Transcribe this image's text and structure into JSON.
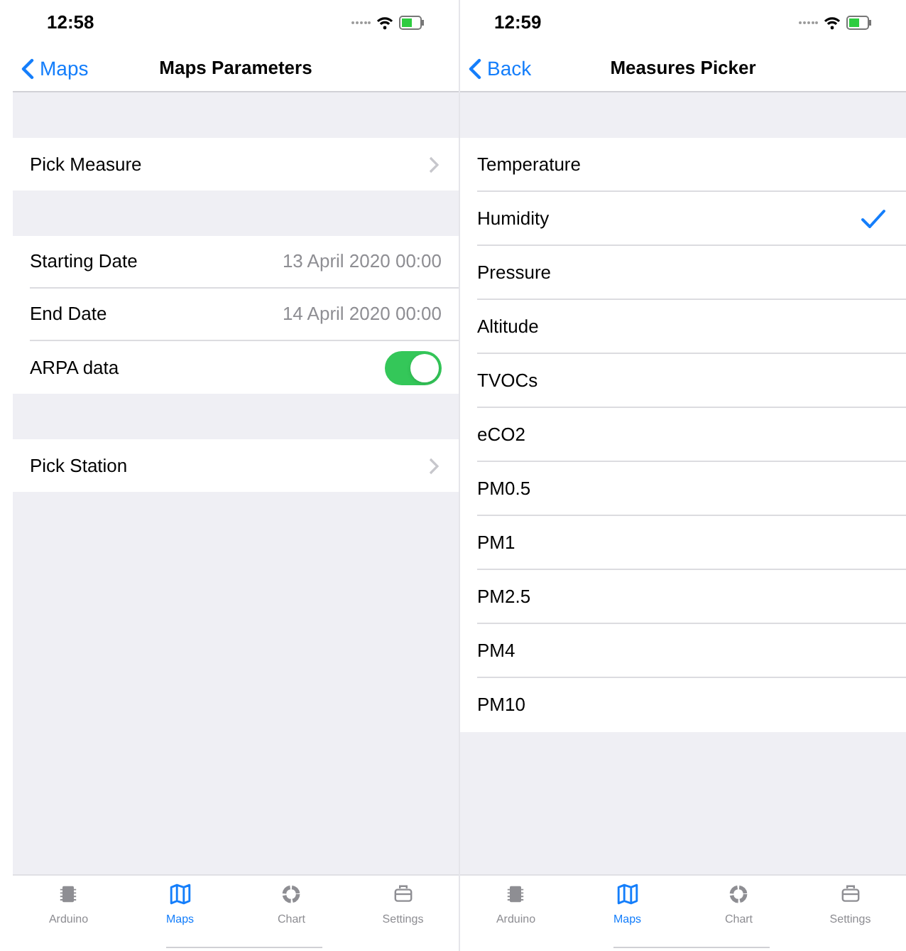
{
  "screens": [
    {
      "status_bar": {
        "time": "12:58"
      },
      "nav": {
        "back": "Maps",
        "title": "Maps Parameters"
      },
      "groups": [
        {
          "rows": [
            {
              "kind": "disclosure",
              "label": "Pick Measure"
            }
          ]
        },
        {
          "rows": [
            {
              "kind": "value",
              "label": "Starting Date",
              "value": "13 April 2020 00:00"
            },
            {
              "kind": "value",
              "label": "End Date",
              "value": "14 April 2020 00:00"
            },
            {
              "kind": "toggle",
              "label": "ARPA data",
              "on": true
            }
          ]
        },
        {
          "rows": [
            {
              "kind": "disclosure",
              "label": "Pick Station"
            }
          ]
        }
      ],
      "tabs": [
        {
          "kind": "chip",
          "label": "Arduino",
          "selected": false
        },
        {
          "kind": "map",
          "label": "Maps",
          "selected": true
        },
        {
          "kind": "ring",
          "label": "Chart",
          "selected": false
        },
        {
          "kind": "case",
          "label": "Settings",
          "selected": false
        }
      ]
    },
    {
      "status_bar": {
        "time": "12:59"
      },
      "nav": {
        "back": "Back",
        "title": "Measures Picker"
      },
      "groups": [
        {
          "rows": [
            {
              "kind": "choice",
              "label": "Temperature",
              "selected": false
            },
            {
              "kind": "choice",
              "label": "Humidity",
              "selected": true
            },
            {
              "kind": "choice",
              "label": "Pressure",
              "selected": false
            },
            {
              "kind": "choice",
              "label": "Altitude",
              "selected": false
            },
            {
              "kind": "choice",
              "label": "TVOCs",
              "selected": false
            },
            {
              "kind": "choice",
              "label": "eCO2",
              "selected": false
            },
            {
              "kind": "choice",
              "label": "PM0.5",
              "selected": false
            },
            {
              "kind": "choice",
              "label": "PM1",
              "selected": false
            },
            {
              "kind": "choice",
              "label": "PM2.5",
              "selected": false
            },
            {
              "kind": "choice",
              "label": "PM4",
              "selected": false
            },
            {
              "kind": "choice",
              "label": "PM10",
              "selected": false
            }
          ]
        }
      ],
      "tabs": [
        {
          "kind": "chip",
          "label": "Arduino",
          "selected": false
        },
        {
          "kind": "map",
          "label": "Maps",
          "selected": true
        },
        {
          "kind": "ring",
          "label": "Chart",
          "selected": false
        },
        {
          "kind": "case",
          "label": "Settings",
          "selected": false
        }
      ]
    }
  ]
}
